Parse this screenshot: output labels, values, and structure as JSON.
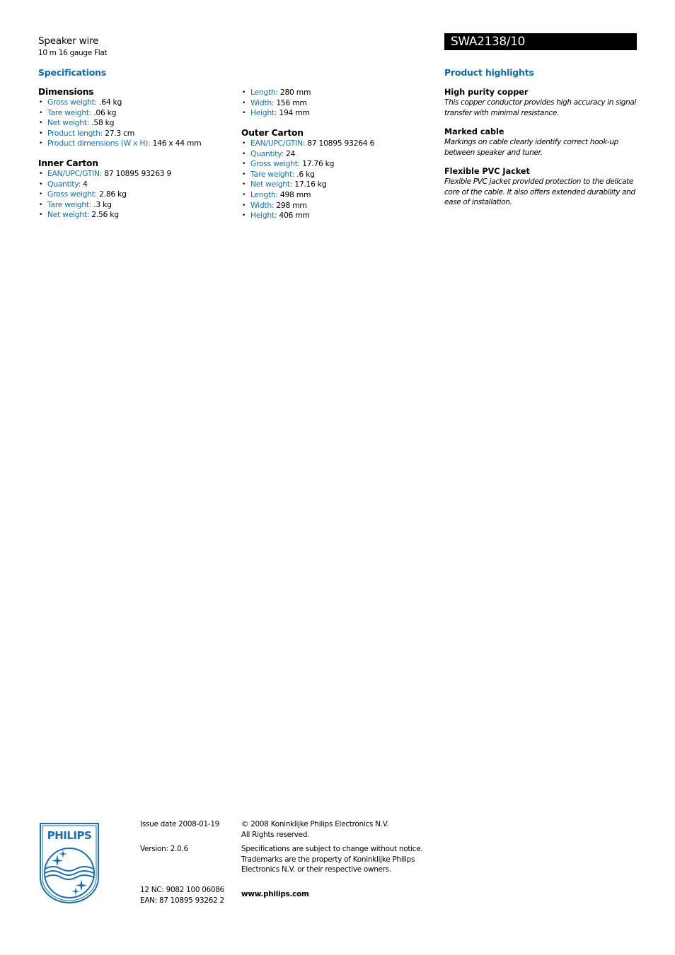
{
  "header": {
    "product_name": "Speaker wire",
    "product_subtitle": "10 m 16 gauge Flat",
    "model": "SWA2138/10"
  },
  "specifications": {
    "title": "Specifications",
    "groups": [
      {
        "title": "Dimensions",
        "items": [
          {
            "label": "Gross weight:",
            "value": ".64 kg"
          },
          {
            "label": "Tare weight:",
            "value": ".06 kg"
          },
          {
            "label": "Net weight:",
            "value": ".58 kg"
          },
          {
            "label": "Product length:",
            "value": "27.3 cm"
          },
          {
            "label": "Product dimensions (W x H):",
            "value": "146 x 44 mm"
          }
        ]
      },
      {
        "title": "Inner Carton",
        "items": [
          {
            "label": "EAN/UPC/GTIN:",
            "value": "87 10895 93263 9"
          },
          {
            "label": "Quantity:",
            "value": "4"
          },
          {
            "label": "Gross weight:",
            "value": "2.86 kg"
          },
          {
            "label": "Tare weight:",
            "value": ".3 kg"
          },
          {
            "label": "Net weight:",
            "value": "2.56 kg"
          }
        ],
        "continued_items": [
          {
            "label": "Length:",
            "value": "280 mm"
          },
          {
            "label": "Width:",
            "value": "156 mm"
          },
          {
            "label": "Height:",
            "value": "194 mm"
          }
        ]
      },
      {
        "title": "Outer Carton",
        "items": [
          {
            "label": "EAN/UPC/GTIN:",
            "value": "87 10895 93264 6"
          },
          {
            "label": "Quantity:",
            "value": "24"
          },
          {
            "label": "Gross weight:",
            "value": "17.76 kg"
          },
          {
            "label": "Tare weight:",
            "value": ".6 kg"
          },
          {
            "label": "Net weight:",
            "value": "17.16 kg"
          },
          {
            "label": "Length:",
            "value": "498 mm"
          },
          {
            "label": "Width:",
            "value": "298 mm"
          },
          {
            "label": "Height:",
            "value": "406 mm"
          }
        ]
      }
    ]
  },
  "highlights": {
    "title": "Product highlights",
    "items": [
      {
        "title": "High purity copper",
        "text": "This copper conductor provides high accuracy in signal transfer with minimal resistance."
      },
      {
        "title": "Marked cable",
        "text": "Markings on cable clearly identify correct hook-up between speaker and tuner."
      },
      {
        "title": "Flexible PVC Jacket",
        "text": "Flexible PVC jacket provided protection to the delicate core of the cable. It also offers extended durability and ease of installation."
      }
    ]
  },
  "footer": {
    "logo_text": "PHILIPS",
    "issue_date": "Issue date 2008-01-19",
    "version": "Version: 2.0.6",
    "nc": "12 NC: 9082 100 06086",
    "ean": "EAN: 87 10895 93262 2",
    "copyright_line1": "© 2008 Koninklijke Philips Electronics N.V.",
    "copyright_line2": "All Rights reserved.",
    "notice_line1": "Specifications are subject to change without notice.",
    "notice_line2": "Trademarks are the property of Koninklijke Philips",
    "notice_line3": "Electronics N.V. or their respective owners.",
    "website": "www.philips.com"
  },
  "colors": {
    "accent_blue": "#0e6aa8",
    "label_blue": "#1a6fb0",
    "model_bar": "#000000"
  }
}
